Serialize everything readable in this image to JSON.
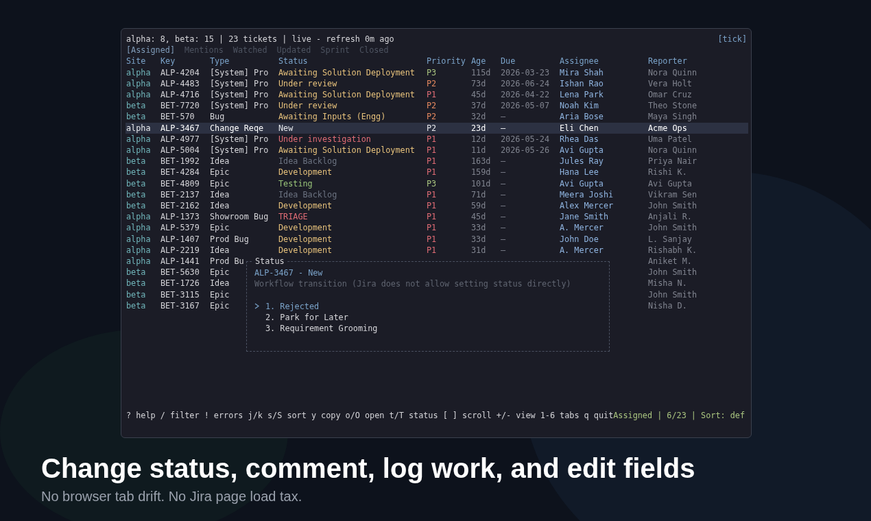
{
  "terminal": {
    "summary": "alpha: 8, beta: 15 | 23 tickets | live - refresh 0m ago",
    "tick": "[tick]",
    "tabs": [
      {
        "label": "[Assigned]",
        "selected": true
      },
      {
        "label": "Mentions",
        "selected": false
      },
      {
        "label": "Watched",
        "selected": false
      },
      {
        "label": "Updated",
        "selected": false
      },
      {
        "label": "Sprint",
        "selected": false
      },
      {
        "label": "Closed",
        "selected": false
      }
    ],
    "columns": [
      "Site",
      "Key",
      "Type",
      "Status",
      "Priority",
      "Age",
      "Due",
      "Assignee",
      "Reporter"
    ],
    "rows": [
      {
        "site": "alpha",
        "key": "ALP-4204",
        "type": "[System] Pro",
        "status": {
          "text": "Awaiting Solution Deployment",
          "color": "#e5c07b"
        },
        "priority": {
          "text": "P3",
          "color": "#a9c47f"
        },
        "age": "115d",
        "due": "2026-03-23",
        "assignee": "Mira Shah",
        "reporter": "Nora Quinn",
        "selected": false
      },
      {
        "site": "alpha",
        "key": "ALP-4483",
        "type": "[System] Pro",
        "status": {
          "text": "Under review",
          "color": "#e5c07b"
        },
        "priority": {
          "text": "P2",
          "color": "#e5895f"
        },
        "age": "73d",
        "due": "2026-06-24",
        "assignee": "Ishan Rao",
        "reporter": "Vera Holt",
        "selected": false
      },
      {
        "site": "alpha",
        "key": "ALP-4716",
        "type": "[System] Pro",
        "status": {
          "text": "Awaiting Solution Deployment",
          "color": "#e5c07b"
        },
        "priority": {
          "text": "P1",
          "color": "#e06c75"
        },
        "age": "45d",
        "due": "2026-04-22",
        "assignee": "Lena Park",
        "reporter": "Omar Cruz",
        "selected": false
      },
      {
        "site": "beta",
        "key": "BET-7720",
        "type": "[System] Pro",
        "status": {
          "text": "Under review",
          "color": "#e5c07b"
        },
        "priority": {
          "text": "P2",
          "color": "#e5895f"
        },
        "age": "37d",
        "due": "2026-05-07",
        "assignee": "Noah Kim",
        "reporter": "Theo Stone",
        "selected": false
      },
      {
        "site": "beta",
        "key": "BET-570",
        "type": "Bug",
        "status": {
          "text": "Awaiting Inputs (Engg)",
          "color": "#e5c07b"
        },
        "priority": {
          "text": "P2",
          "color": "#e5895f"
        },
        "age": "32d",
        "due": "–",
        "assignee": "Aria Bose",
        "reporter": "Maya Singh",
        "selected": false
      },
      {
        "site": "alpha",
        "key": "ALP-3467",
        "type": "Change Reqe",
        "status": {
          "text": "New",
          "color": "#e5e7eb"
        },
        "priority": {
          "text": "P2",
          "color": "#e5e7eb"
        },
        "age": "23d",
        "due": "–",
        "assignee": "Eli Chen",
        "reporter": "Acme Ops",
        "selected": true
      },
      {
        "site": "alpha",
        "key": "ALP-4977",
        "type": "[System] Pro",
        "status": {
          "text": "Under investigation",
          "color": "#e06c75"
        },
        "priority": {
          "text": "P1",
          "color": "#e06c75"
        },
        "age": "12d",
        "due": "2026-05-24",
        "assignee": "Rhea Das",
        "reporter": "Uma Patel",
        "selected": false
      },
      {
        "site": "alpha",
        "key": "ALP-5004",
        "type": "[System] Pro",
        "status": {
          "text": "Awaiting Solution Deployment",
          "color": "#e5c07b"
        },
        "priority": {
          "text": "P1",
          "color": "#e06c75"
        },
        "age": "11d",
        "due": "2026-05-26",
        "assignee": "Avi Gupta",
        "reporter": "Nora Quinn",
        "selected": false
      },
      {
        "site": "beta",
        "key": "BET-1992",
        "type": "Idea",
        "status": {
          "text": "Idea Backlog",
          "color": "#6b7280"
        },
        "priority": {
          "text": "P1",
          "color": "#e06c75"
        },
        "age": "163d",
        "due": "–",
        "assignee": "Jules Ray",
        "reporter": "Priya Nair",
        "selected": false
      },
      {
        "site": "beta",
        "key": "BET-4284",
        "type": "Epic",
        "status": {
          "text": "Development",
          "color": "#e5c07b"
        },
        "priority": {
          "text": "P1",
          "color": "#e06c75"
        },
        "age": "159d",
        "due": "–",
        "assignee": "Hana Lee",
        "reporter": "Rishi K.",
        "selected": false
      },
      {
        "site": "beta",
        "key": "BET-4809",
        "type": "Epic",
        "status": {
          "text": "Testing",
          "color": "#98c379"
        },
        "priority": {
          "text": "P3",
          "color": "#a9c47f"
        },
        "age": "101d",
        "due": "–",
        "assignee": "Avi Gupta",
        "reporter": "Avi Gupta",
        "selected": false
      },
      {
        "site": "beta",
        "key": "BET-2137",
        "type": "Idea",
        "status": {
          "text": "Idea Backlog",
          "color": "#6b7280"
        },
        "priority": {
          "text": "P1",
          "color": "#e06c75"
        },
        "age": "71d",
        "due": "–",
        "assignee": "Meera Joshi",
        "reporter": "Vikram Sen",
        "selected": false
      },
      {
        "site": "beta",
        "key": "BET-2162",
        "type": "Idea",
        "status": {
          "text": "Development",
          "color": "#e5c07b"
        },
        "priority": {
          "text": "P1",
          "color": "#e06c75"
        },
        "age": "59d",
        "due": "–",
        "assignee": "Alex Mercer",
        "reporter": "John Smith",
        "selected": false
      },
      {
        "site": "alpha",
        "key": "ALP-1373",
        "type": "Showroom Bug",
        "status": {
          "text": "TRIAGE",
          "color": "#e06c75"
        },
        "priority": {
          "text": "P1",
          "color": "#e06c75"
        },
        "age": "45d",
        "due": "–",
        "assignee": "Jane Smith",
        "reporter": "Anjali R.",
        "selected": false
      },
      {
        "site": "alpha",
        "key": "ALP-5379",
        "type": "Epic",
        "status": {
          "text": "Development",
          "color": "#e5c07b"
        },
        "priority": {
          "text": "P1",
          "color": "#e06c75"
        },
        "age": "33d",
        "due": "–",
        "assignee": "A. Mercer",
        "reporter": "John Smith",
        "selected": false
      },
      {
        "site": "alpha",
        "key": "ALP-1407",
        "type": "Prod Bug",
        "status": {
          "text": "Development",
          "color": "#e5c07b"
        },
        "priority": {
          "text": "P1",
          "color": "#e06c75"
        },
        "age": "33d",
        "due": "–",
        "assignee": "John Doe",
        "reporter": "L. Sanjay",
        "selected": false
      },
      {
        "site": "alpha",
        "key": "ALP-2219",
        "type": "Idea",
        "status": {
          "text": "Development",
          "color": "#e5c07b"
        },
        "priority": {
          "text": "P1",
          "color": "#e06c75"
        },
        "age": "31d",
        "due": "–",
        "assignee": "A. Mercer",
        "reporter": "Rishabh K.",
        "selected": false
      },
      {
        "site": "alpha",
        "key": "ALP-1441",
        "type": "Prod Bu",
        "reporter": "Aniket M.",
        "selected": false
      },
      {
        "site": "beta",
        "key": "BET-5630",
        "type": "Epic",
        "reporter": "John Smith",
        "selected": false
      },
      {
        "site": "beta",
        "key": "BET-1726",
        "type": "Idea",
        "reporter": "Misha N.",
        "selected": false
      },
      {
        "site": "beta",
        "key": "BET-3115",
        "type": "Epic",
        "reporter": "John Smith",
        "selected": false
      },
      {
        "site": "beta",
        "key": "BET-3167",
        "type": "Epic",
        "reporter": "Nisha D.",
        "selected": false
      }
    ],
    "dialog": {
      "title": "Status",
      "ticket": "ALP-3467 - New",
      "note": "Workflow transition (Jira does not allow setting status directly)",
      "options": [
        {
          "label": "1. Rejected",
          "selected": true
        },
        {
          "label": "2. Park for Later",
          "selected": false
        },
        {
          "label": "3. Requirement Grooming",
          "selected": false
        }
      ]
    },
    "footer": {
      "keys": "? help / filter ! errors j/k s/S sort y copy o/O open t/T status [ ] scroll +/- view 1-6 tabs q quit",
      "status": "Assigned | 6/23 | Sort: def"
    }
  },
  "headline": "Change status, comment, log work, and edit fields",
  "subline": "No browser tab drift. No Jira page load tax."
}
